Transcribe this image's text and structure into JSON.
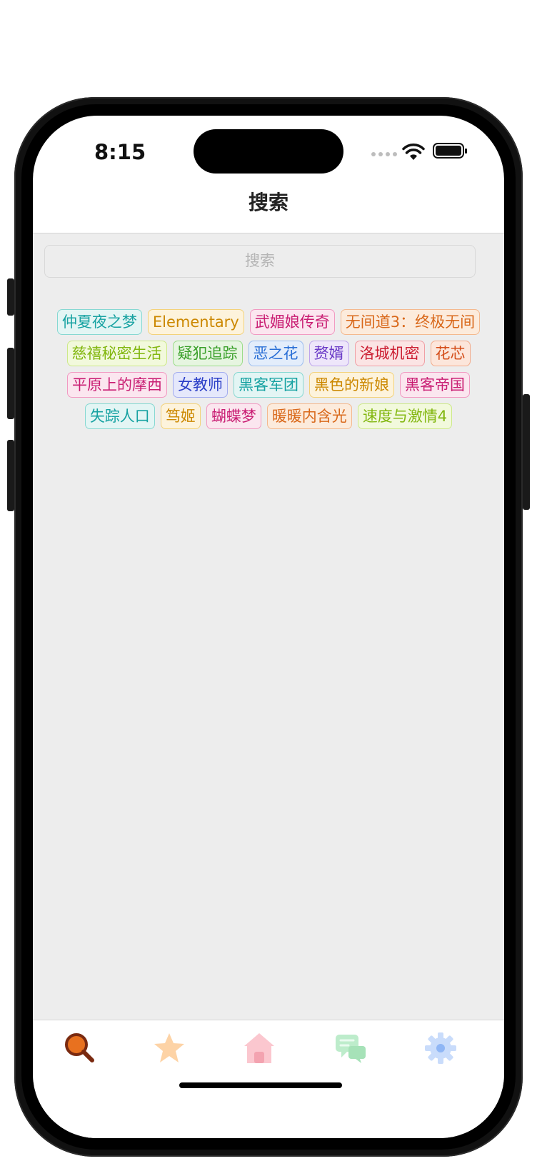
{
  "status_bar": {
    "time": "8:15"
  },
  "nav": {
    "title": "搜索"
  },
  "search": {
    "placeholder": "搜索"
  },
  "tags": [
    {
      "label": "仲夏夜之梦",
      "color": "#17a2a2",
      "bg": "#e3f5f4",
      "border": "#86d8d2"
    },
    {
      "label": "Elementary",
      "color": "#cc8800",
      "bg": "#fdf3dc",
      "border": "#f3d27a"
    },
    {
      "label": "武媚娘传奇",
      "color": "#c91d73",
      "bg": "#fbe6ef",
      "border": "#f19ac2"
    },
    {
      "label": "无间道3：终极无间",
      "color": "#d9681a",
      "bg": "#fcebdc",
      "border": "#f4b98e"
    },
    {
      "label": "慈禧秘密生活",
      "color": "#82b70f",
      "bg": "#f2f9dc",
      "border": "#cde98a"
    },
    {
      "label": "疑犯追踪",
      "color": "#3aa02a",
      "bg": "#e6f5e0",
      "border": "#9bdc8a"
    },
    {
      "label": "恶之花",
      "color": "#2a6fd6",
      "bg": "#e3edfb",
      "border": "#9dbff0"
    },
    {
      "label": "赘婿",
      "color": "#6a3ac7",
      "bg": "#eee6fa",
      "border": "#bda4ec"
    },
    {
      "label": "洛城机密",
      "color": "#cc2033",
      "bg": "#fbe4e4",
      "border": "#f09fa5"
    },
    {
      "label": "花芯",
      "color": "#d44e1a",
      "bg": "#fce6db",
      "border": "#f3ac8c"
    },
    {
      "label": "平原上的摩西",
      "color": "#c91d73",
      "bg": "#fbe6ef",
      "border": "#f19ac2"
    },
    {
      "label": "女教师",
      "color": "#2a3ec7",
      "bg": "#e5e8fb",
      "border": "#a2acef"
    },
    {
      "label": "黑客军团",
      "color": "#17a2a2",
      "bg": "#e3f5f4",
      "border": "#86d8d2"
    },
    {
      "label": "黑色的新娘",
      "color": "#cc8800",
      "bg": "#fdf3dc",
      "border": "#f3d27a"
    },
    {
      "label": "黑客帝国",
      "color": "#c91d73",
      "bg": "#fbe6ef",
      "border": "#f19ac2"
    },
    {
      "label": "失踪人口",
      "color": "#17a2a2",
      "bg": "#e3f5f4",
      "border": "#86d8d2"
    },
    {
      "label": "笃姬",
      "color": "#cc8800",
      "bg": "#fdf3dc",
      "border": "#f3d27a"
    },
    {
      "label": "蝴蝶梦",
      "color": "#c91d73",
      "bg": "#fbe6ef",
      "border": "#f19ac2"
    },
    {
      "label": "暖暖内含光",
      "color": "#d9681a",
      "bg": "#fcebdc",
      "border": "#f4b98e"
    },
    {
      "label": "速度与激情4",
      "color": "#82b70f",
      "bg": "#f2f9dc",
      "border": "#cde98a"
    }
  ],
  "tabbar": {
    "items": [
      {
        "icon": "search-icon",
        "color": "#e8711f",
        "active": true
      },
      {
        "icon": "star-icon",
        "color": "#fdd3a6",
        "active": false
      },
      {
        "icon": "home-icon",
        "color": "#fbc7cf",
        "active": false
      },
      {
        "icon": "chat-icon",
        "color": "#bdeccb",
        "active": false
      },
      {
        "icon": "gear-icon",
        "color": "#c9dcfb",
        "active": false
      }
    ]
  }
}
